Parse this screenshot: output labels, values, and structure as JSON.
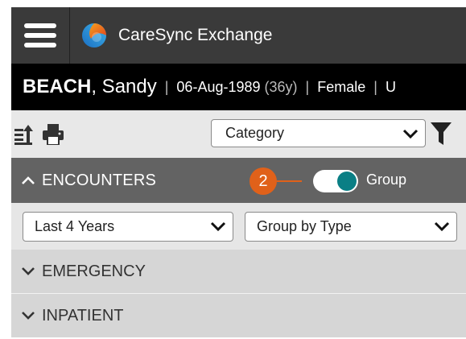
{
  "app": {
    "title": "CareSync Exchange",
    "logo_icon": "app-logo-icon",
    "menu_icon": "hamburger-menu-icon"
  },
  "patient": {
    "last_name": "BEACH",
    "first_name": ", Sandy",
    "dob": "06-Aug-1989",
    "age": "(36y)",
    "sex": "Female",
    "trailing_text": "U",
    "separator": "|"
  },
  "toolbar": {
    "export_icon": "export-icon",
    "print_icon": "print-icon",
    "category_select": {
      "value": "Category"
    },
    "filter_icon": "filter-icon"
  },
  "section": {
    "title": "ENCOUNTERS",
    "expanded": true,
    "callout_number": "2",
    "group_toggle_label": "Group",
    "group_toggle_on": true
  },
  "filters": {
    "date_range": "Last 4 Years",
    "group_by": "Group by Type"
  },
  "groups": [
    {
      "label": "EMERGENCY",
      "expanded": false
    },
    {
      "label": "INPATIENT",
      "expanded": false
    }
  ],
  "colors": {
    "header_bg": "#3a3a3a",
    "banner_bg": "#000000",
    "section_bg": "#636363",
    "callout": "#e0611a",
    "toggle_knob": "#0a7f85",
    "group_row_bg": "#d6d6d6"
  }
}
